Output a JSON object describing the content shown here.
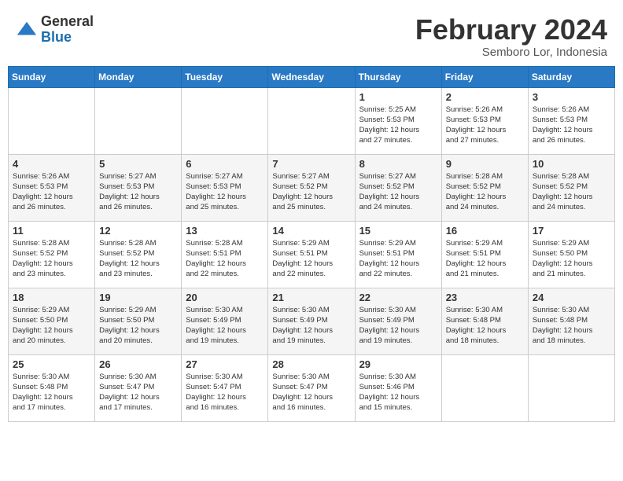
{
  "logo": {
    "general": "General",
    "blue": "Blue",
    "arrow_color": "#2979c5"
  },
  "header": {
    "month": "February 2024",
    "location": "Semboro Lor, Indonesia"
  },
  "weekdays": [
    "Sunday",
    "Monday",
    "Tuesday",
    "Wednesday",
    "Thursday",
    "Friday",
    "Saturday"
  ],
  "weeks": [
    [
      {
        "day": "",
        "info": ""
      },
      {
        "day": "",
        "info": ""
      },
      {
        "day": "",
        "info": ""
      },
      {
        "day": "",
        "info": ""
      },
      {
        "day": "1",
        "info": "Sunrise: 5:25 AM\nSunset: 5:53 PM\nDaylight: 12 hours\nand 27 minutes."
      },
      {
        "day": "2",
        "info": "Sunrise: 5:26 AM\nSunset: 5:53 PM\nDaylight: 12 hours\nand 27 minutes."
      },
      {
        "day": "3",
        "info": "Sunrise: 5:26 AM\nSunset: 5:53 PM\nDaylight: 12 hours\nand 26 minutes."
      }
    ],
    [
      {
        "day": "4",
        "info": "Sunrise: 5:26 AM\nSunset: 5:53 PM\nDaylight: 12 hours\nand 26 minutes."
      },
      {
        "day": "5",
        "info": "Sunrise: 5:27 AM\nSunset: 5:53 PM\nDaylight: 12 hours\nand 26 minutes."
      },
      {
        "day": "6",
        "info": "Sunrise: 5:27 AM\nSunset: 5:53 PM\nDaylight: 12 hours\nand 25 minutes."
      },
      {
        "day": "7",
        "info": "Sunrise: 5:27 AM\nSunset: 5:52 PM\nDaylight: 12 hours\nand 25 minutes."
      },
      {
        "day": "8",
        "info": "Sunrise: 5:27 AM\nSunset: 5:52 PM\nDaylight: 12 hours\nand 24 minutes."
      },
      {
        "day": "9",
        "info": "Sunrise: 5:28 AM\nSunset: 5:52 PM\nDaylight: 12 hours\nand 24 minutes."
      },
      {
        "day": "10",
        "info": "Sunrise: 5:28 AM\nSunset: 5:52 PM\nDaylight: 12 hours\nand 24 minutes."
      }
    ],
    [
      {
        "day": "11",
        "info": "Sunrise: 5:28 AM\nSunset: 5:52 PM\nDaylight: 12 hours\nand 23 minutes."
      },
      {
        "day": "12",
        "info": "Sunrise: 5:28 AM\nSunset: 5:52 PM\nDaylight: 12 hours\nand 23 minutes."
      },
      {
        "day": "13",
        "info": "Sunrise: 5:28 AM\nSunset: 5:51 PM\nDaylight: 12 hours\nand 22 minutes."
      },
      {
        "day": "14",
        "info": "Sunrise: 5:29 AM\nSunset: 5:51 PM\nDaylight: 12 hours\nand 22 minutes."
      },
      {
        "day": "15",
        "info": "Sunrise: 5:29 AM\nSunset: 5:51 PM\nDaylight: 12 hours\nand 22 minutes."
      },
      {
        "day": "16",
        "info": "Sunrise: 5:29 AM\nSunset: 5:51 PM\nDaylight: 12 hours\nand 21 minutes."
      },
      {
        "day": "17",
        "info": "Sunrise: 5:29 AM\nSunset: 5:50 PM\nDaylight: 12 hours\nand 21 minutes."
      }
    ],
    [
      {
        "day": "18",
        "info": "Sunrise: 5:29 AM\nSunset: 5:50 PM\nDaylight: 12 hours\nand 20 minutes."
      },
      {
        "day": "19",
        "info": "Sunrise: 5:29 AM\nSunset: 5:50 PM\nDaylight: 12 hours\nand 20 minutes."
      },
      {
        "day": "20",
        "info": "Sunrise: 5:30 AM\nSunset: 5:49 PM\nDaylight: 12 hours\nand 19 minutes."
      },
      {
        "day": "21",
        "info": "Sunrise: 5:30 AM\nSunset: 5:49 PM\nDaylight: 12 hours\nand 19 minutes."
      },
      {
        "day": "22",
        "info": "Sunrise: 5:30 AM\nSunset: 5:49 PM\nDaylight: 12 hours\nand 19 minutes."
      },
      {
        "day": "23",
        "info": "Sunrise: 5:30 AM\nSunset: 5:48 PM\nDaylight: 12 hours\nand 18 minutes."
      },
      {
        "day": "24",
        "info": "Sunrise: 5:30 AM\nSunset: 5:48 PM\nDaylight: 12 hours\nand 18 minutes."
      }
    ],
    [
      {
        "day": "25",
        "info": "Sunrise: 5:30 AM\nSunset: 5:48 PM\nDaylight: 12 hours\nand 17 minutes."
      },
      {
        "day": "26",
        "info": "Sunrise: 5:30 AM\nSunset: 5:47 PM\nDaylight: 12 hours\nand 17 minutes."
      },
      {
        "day": "27",
        "info": "Sunrise: 5:30 AM\nSunset: 5:47 PM\nDaylight: 12 hours\nand 16 minutes."
      },
      {
        "day": "28",
        "info": "Sunrise: 5:30 AM\nSunset: 5:47 PM\nDaylight: 12 hours\nand 16 minutes."
      },
      {
        "day": "29",
        "info": "Sunrise: 5:30 AM\nSunset: 5:46 PM\nDaylight: 12 hours\nand 15 minutes."
      },
      {
        "day": "",
        "info": ""
      },
      {
        "day": "",
        "info": ""
      }
    ]
  ]
}
